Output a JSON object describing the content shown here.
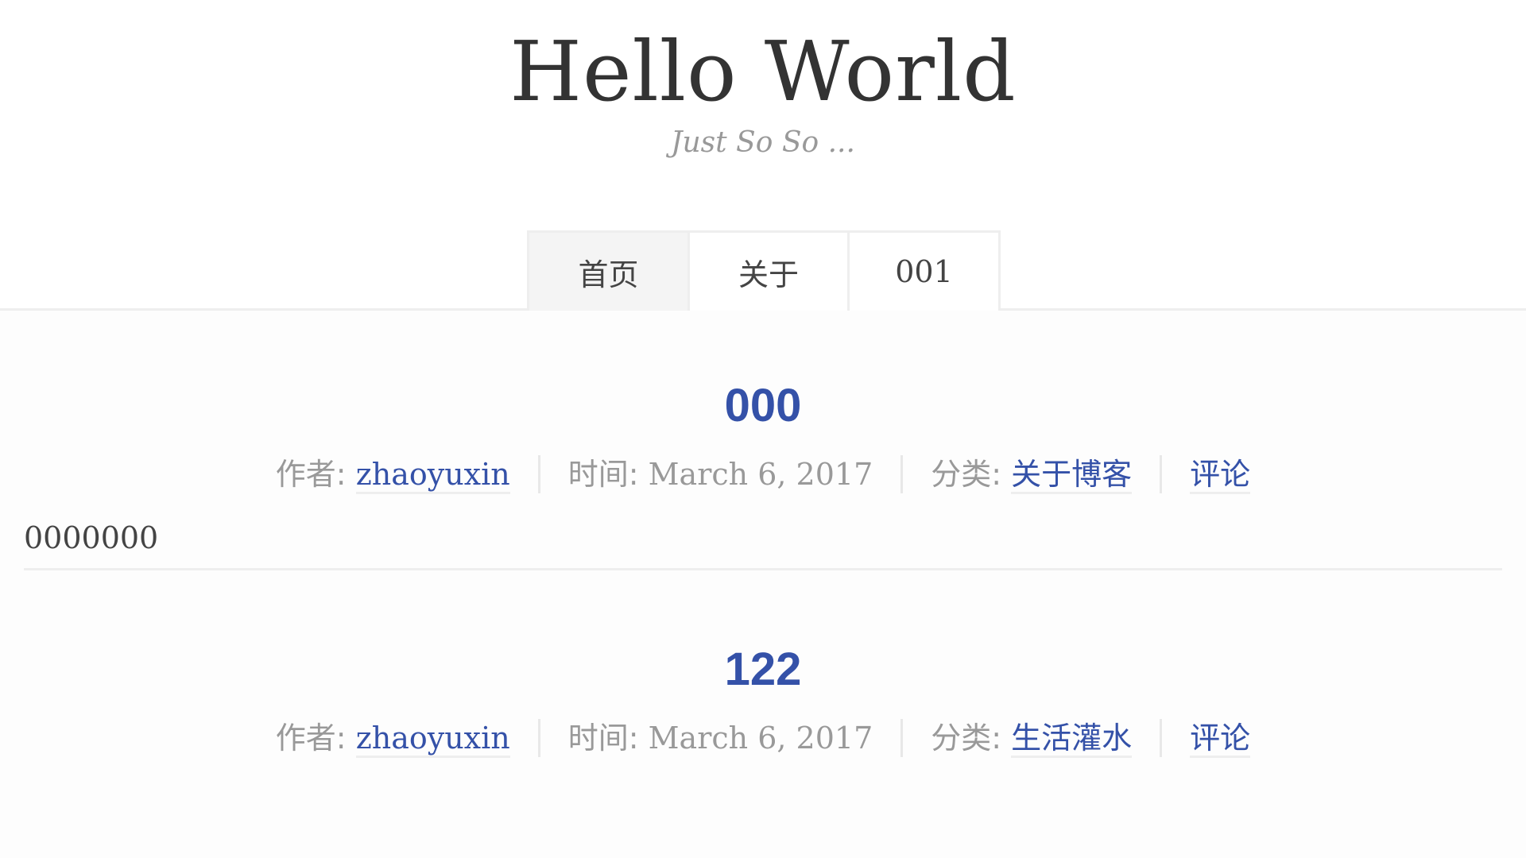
{
  "header": {
    "title": "Hello World",
    "subtitle": "Just So So ..."
  },
  "nav": {
    "items": [
      {
        "label": "首页",
        "active": true
      },
      {
        "label": "关于",
        "active": false
      },
      {
        "label": "001",
        "active": false
      }
    ]
  },
  "posts": [
    {
      "title": "000",
      "author_label": "作者:",
      "author": "zhaoyuxin",
      "time_label": "时间:",
      "time": "March 6, 2017",
      "category_label": "分类:",
      "category": "关于博客",
      "comments_label": "评论",
      "body": "0000000"
    },
    {
      "title": "122",
      "author_label": "作者:",
      "author": "zhaoyuxin",
      "time_label": "时间:",
      "time": "March 6, 2017",
      "category_label": "分类:",
      "category": "生活灌水",
      "comments_label": "评论"
    }
  ],
  "colors": {
    "link": "#3451a8",
    "text": "#333333",
    "muted": "#999999",
    "border": "#eeeeee"
  }
}
